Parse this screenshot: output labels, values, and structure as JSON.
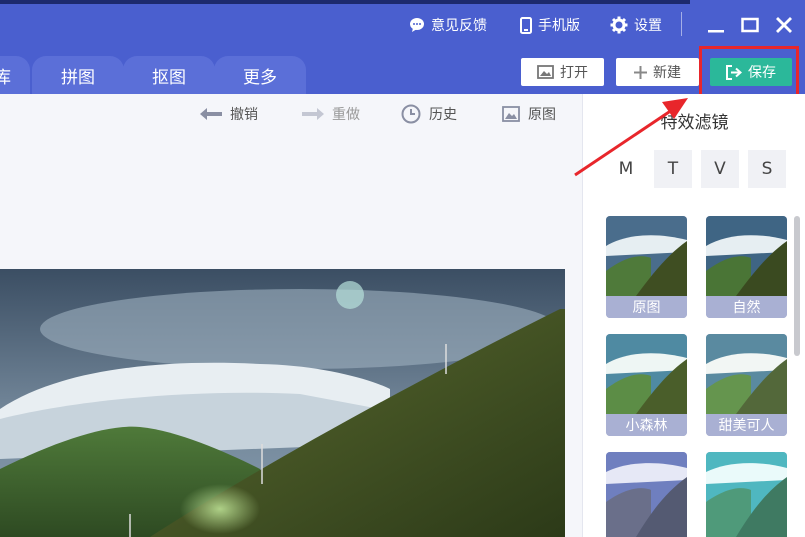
{
  "titlebar": {
    "feedback_label": "意见反馈",
    "mobile_label": "手机版",
    "settings_label": "设置"
  },
  "tabs": [
    {
      "label": "库"
    },
    {
      "label": "拼图"
    },
    {
      "label": "抠图"
    },
    {
      "label": "更多"
    }
  ],
  "actions": {
    "open_label": "打开",
    "new_label": "新建",
    "save_label": "保存"
  },
  "toolbar": {
    "undo_label": "撤销",
    "redo_label": "重做",
    "history_label": "历史",
    "original_label": "原图"
  },
  "panel": {
    "title": "特效滤镜",
    "categories": [
      "M",
      "T",
      "V",
      "S"
    ],
    "filters": [
      {
        "label": "原图"
      },
      {
        "label": "自然"
      },
      {
        "label": "小森林"
      },
      {
        "label": "甜美可人"
      },
      {
        "label": ""
      },
      {
        "label": ""
      }
    ]
  },
  "colors": {
    "brand": "#4a5fcf",
    "save": "#2bb89a",
    "highlight": "#e8262b"
  }
}
